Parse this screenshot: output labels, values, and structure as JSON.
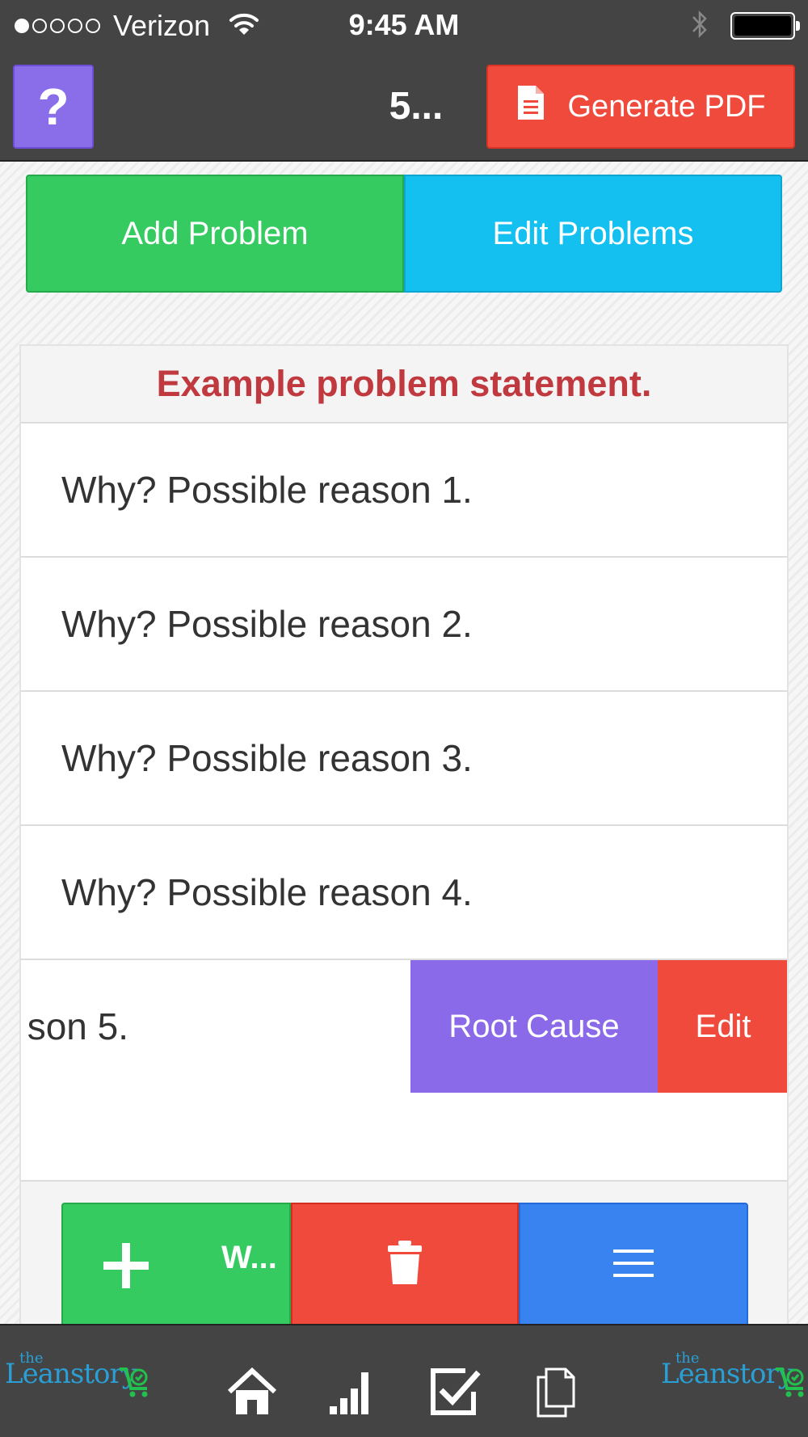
{
  "status_bar": {
    "carrier": "Verizon",
    "time": "9:45 AM",
    "signal_bars": 1,
    "signal_total": 5,
    "icons": [
      "wifi-icon",
      "bluetooth-icon",
      "battery-icon"
    ]
  },
  "nav": {
    "help_label": "?",
    "title": "5...",
    "generate_pdf_label": "Generate PDF",
    "pdf_icon": "document-icon"
  },
  "top_buttons": {
    "add_problem": "Add Problem",
    "edit_problems": "Edit Problems"
  },
  "problem": {
    "statement": "Example problem statement.",
    "reasons": [
      "Why? Possible reason 1.",
      "Why? Possible reason 2.",
      "Why? Possible reason 3.",
      "Why? Possible reason 4."
    ],
    "swiped_reason_text": "son 5.",
    "swipe_actions": {
      "root_cause": "Root Cause",
      "edit": "Edit"
    }
  },
  "action_bar": {
    "add_why_label": "W...",
    "icons": [
      "plus-icon",
      "trash-icon",
      "menu-icon"
    ]
  },
  "tab_bar": {
    "logo_the": "the",
    "logo_word": "Leanstory",
    "tabs": [
      "home-icon",
      "signal-chart-icon",
      "checkbox-icon",
      "documents-icon"
    ]
  },
  "colors": {
    "dark_bar": "#444444",
    "purple": "#8a6ee9",
    "red": "#ef4a3c",
    "green": "#35cb60",
    "cyan": "#13c0f0",
    "blue": "#3983f0",
    "problem_red": "#c0393f",
    "logo_blue": "#2a9fd6",
    "logo_green": "#22c04d"
  }
}
